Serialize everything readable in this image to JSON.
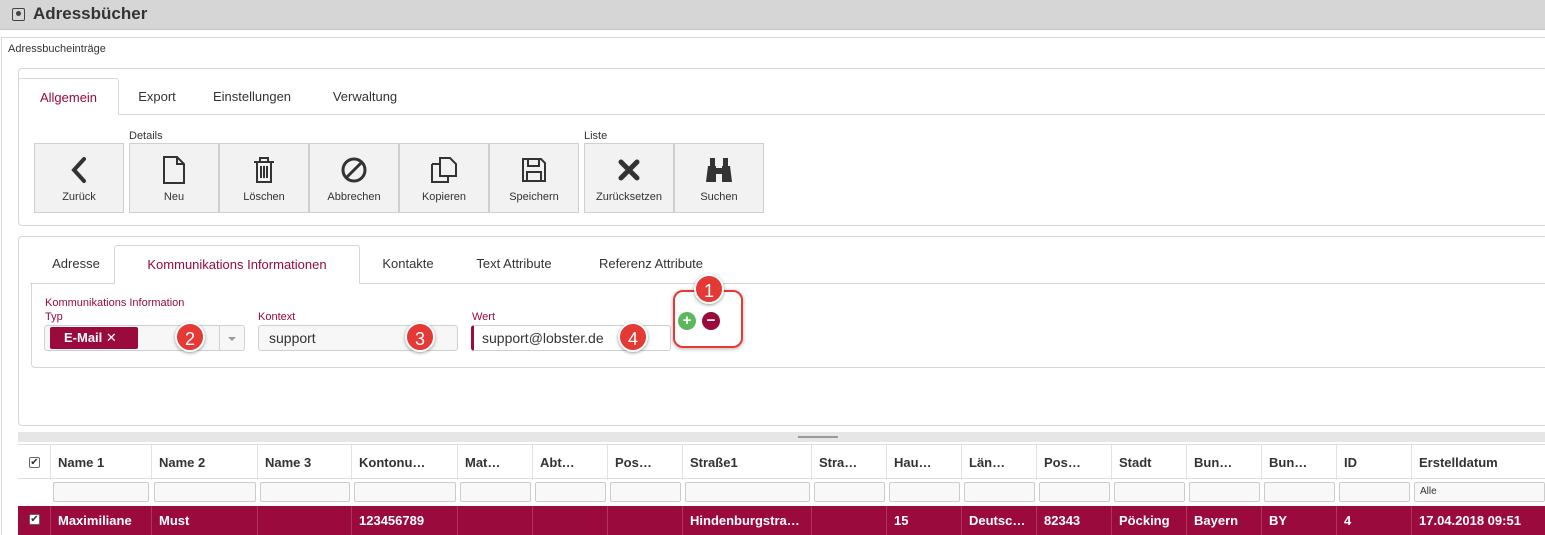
{
  "app": {
    "title": "Adressbücher"
  },
  "panel": {
    "title": "Adressbucheinträge"
  },
  "main_tabs": [
    "Allgemein",
    "Export",
    "Einstellungen",
    "Verwaltung"
  ],
  "toolbar": {
    "group_details": "Details",
    "group_liste": "Liste",
    "buttons": [
      "Zurück",
      "Neu",
      "Löschen",
      "Abbrechen",
      "Kopieren",
      "Speichern",
      "Zurücksetzen",
      "Suchen"
    ]
  },
  "sub_tabs": [
    "Adresse",
    "Kommunikations Informationen",
    "Kontakte",
    "Text Attribute",
    "Referenz Attribute"
  ],
  "form": {
    "typ_label_1": "Kommunikations Information",
    "typ_label_2": "Typ",
    "typ_value": "E-Mail ✕",
    "kontext_label": "Kontext",
    "kontext_value": "support",
    "wert_label": "Wert",
    "wert_value": "support@lobster.de"
  },
  "badges": [
    "1",
    "2",
    "3",
    "4"
  ],
  "action_buttons": {
    "add": "+",
    "remove": "−"
  },
  "grid": {
    "columns": [
      "Name 1",
      "Name 2",
      "Name 3",
      "Kontonu…",
      "Mat…",
      "Abt…",
      "Pos…",
      "Straße1",
      "Stra…",
      "Hau…",
      "Län…",
      "Pos…",
      "Stadt",
      "Bun…",
      "Bun…",
      "ID",
      "Erstelldatum"
    ],
    "filter_select": "Alle",
    "row": [
      "Maximiliane",
      "Must",
      "",
      "123456789",
      "",
      "",
      "",
      "Hindenburgstra…",
      "",
      "15",
      "Deutsc…",
      "82343",
      "Pöcking",
      "Bayern",
      "BY",
      "4",
      "17.04.2018 09:51"
    ],
    "checkmark": "✔"
  },
  "colors": {
    "accent": "#9a0a3c",
    "badge": "#e53935",
    "add": "#5cb85c",
    "remove": "#9a0a3c"
  }
}
